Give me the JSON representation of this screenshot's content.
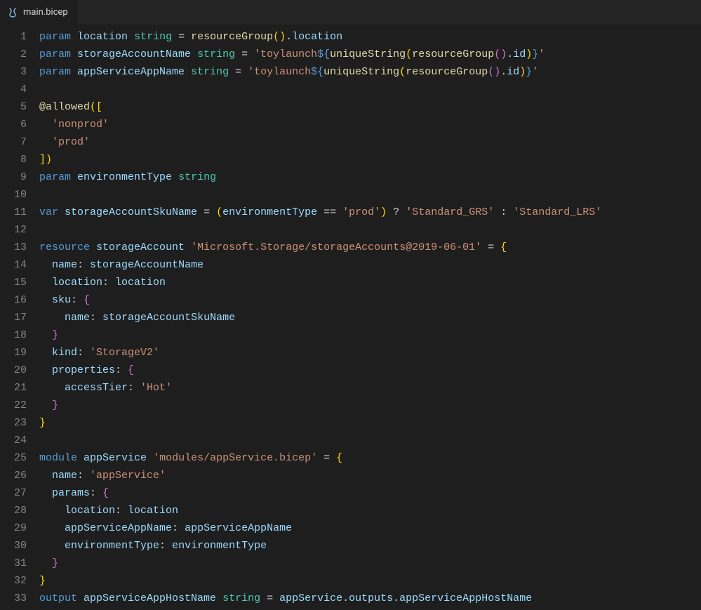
{
  "tab": {
    "filename": "main.bicep"
  },
  "colors": {
    "keyword": "#569cd6",
    "identifier": "#9cdcfe",
    "type": "#4ec9b0",
    "string": "#ce9178",
    "brace1": "#ffd602",
    "brace2": "#d36fd0",
    "function": "#dcdcaa",
    "default": "#d4d4d4",
    "gutter": "#858585",
    "bg": "#1e1e1e"
  },
  "code": [
    [
      {
        "c": "kw",
        "t": "param"
      },
      {
        "c": "op",
        "t": " "
      },
      {
        "c": "ident",
        "t": "location"
      },
      {
        "c": "op",
        "t": " "
      },
      {
        "c": "type",
        "t": "string"
      },
      {
        "c": "op",
        "t": " = "
      },
      {
        "c": "func",
        "t": "resourceGroup"
      },
      {
        "c": "brace",
        "t": "()"
      },
      {
        "c": "op",
        "t": "."
      },
      {
        "c": "ident",
        "t": "location"
      }
    ],
    [
      {
        "c": "kw",
        "t": "param"
      },
      {
        "c": "op",
        "t": " "
      },
      {
        "c": "ident",
        "t": "storageAccountName"
      },
      {
        "c": "op",
        "t": " "
      },
      {
        "c": "type",
        "t": "string"
      },
      {
        "c": "op",
        "t": " = "
      },
      {
        "c": "str",
        "t": "'toylaunch"
      },
      {
        "c": "kw",
        "t": "${"
      },
      {
        "c": "func",
        "t": "uniqueString"
      },
      {
        "c": "gold",
        "t": "("
      },
      {
        "c": "func",
        "t": "resourceGroup"
      },
      {
        "c": "brace2",
        "t": "()"
      },
      {
        "c": "op",
        "t": "."
      },
      {
        "c": "ident",
        "t": "id"
      },
      {
        "c": "gold",
        "t": ")"
      },
      {
        "c": "kw",
        "t": "}"
      },
      {
        "c": "str",
        "t": "'"
      }
    ],
    [
      {
        "c": "kw",
        "t": "param"
      },
      {
        "c": "op",
        "t": " "
      },
      {
        "c": "ident",
        "t": "appServiceAppName"
      },
      {
        "c": "op",
        "t": " "
      },
      {
        "c": "type",
        "t": "string"
      },
      {
        "c": "op",
        "t": " = "
      },
      {
        "c": "str",
        "t": "'toylaunch"
      },
      {
        "c": "kw",
        "t": "${"
      },
      {
        "c": "func",
        "t": "uniqueString"
      },
      {
        "c": "gold",
        "t": "("
      },
      {
        "c": "func",
        "t": "resourceGroup"
      },
      {
        "c": "brace2",
        "t": "()"
      },
      {
        "c": "op",
        "t": "."
      },
      {
        "c": "ident",
        "t": "id"
      },
      {
        "c": "gold",
        "t": ")"
      },
      {
        "c": "kw",
        "t": "}"
      },
      {
        "c": "str",
        "t": "'"
      }
    ],
    [],
    [
      {
        "c": "at",
        "t": "@allowed"
      },
      {
        "c": "brace",
        "t": "(["
      }
    ],
    [
      {
        "c": "op",
        "t": "  "
      },
      {
        "c": "str",
        "t": "'nonprod'"
      }
    ],
    [
      {
        "c": "op",
        "t": "  "
      },
      {
        "c": "str",
        "t": "'prod'"
      }
    ],
    [
      {
        "c": "brace",
        "t": "])"
      }
    ],
    [
      {
        "c": "kw",
        "t": "param"
      },
      {
        "c": "op",
        "t": " "
      },
      {
        "c": "ident",
        "t": "environmentType"
      },
      {
        "c": "op",
        "t": " "
      },
      {
        "c": "type",
        "t": "string"
      }
    ],
    [],
    [
      {
        "c": "kw",
        "t": "var"
      },
      {
        "c": "op",
        "t": " "
      },
      {
        "c": "ident",
        "t": "storageAccountSkuName"
      },
      {
        "c": "op",
        "t": " = "
      },
      {
        "c": "brace",
        "t": "("
      },
      {
        "c": "ident",
        "t": "environmentType"
      },
      {
        "c": "op",
        "t": " == "
      },
      {
        "c": "str",
        "t": "'prod'"
      },
      {
        "c": "brace",
        "t": ")"
      },
      {
        "c": "op",
        "t": " ? "
      },
      {
        "c": "str",
        "t": "'Standard_GRS'"
      },
      {
        "c": "op",
        "t": " : "
      },
      {
        "c": "str",
        "t": "'Standard_LRS'"
      }
    ],
    [],
    [
      {
        "c": "kw",
        "t": "resource"
      },
      {
        "c": "op",
        "t": " "
      },
      {
        "c": "ident",
        "t": "storageAccount"
      },
      {
        "c": "op",
        "t": " "
      },
      {
        "c": "str",
        "t": "'Microsoft.Storage/storageAccounts@2019-06-01'"
      },
      {
        "c": "op",
        "t": " = "
      },
      {
        "c": "brace",
        "t": "{"
      }
    ],
    [
      {
        "c": "op",
        "t": "  "
      },
      {
        "c": "ident",
        "t": "name"
      },
      {
        "c": "op",
        "t": ": "
      },
      {
        "c": "ident",
        "t": "storageAccountName"
      }
    ],
    [
      {
        "c": "op",
        "t": "  "
      },
      {
        "c": "ident",
        "t": "location"
      },
      {
        "c": "op",
        "t": ": "
      },
      {
        "c": "ident",
        "t": "location"
      }
    ],
    [
      {
        "c": "op",
        "t": "  "
      },
      {
        "c": "ident",
        "t": "sku"
      },
      {
        "c": "op",
        "t": ": "
      },
      {
        "c": "brace2",
        "t": "{"
      }
    ],
    [
      {
        "c": "op",
        "t": "    "
      },
      {
        "c": "ident",
        "t": "name"
      },
      {
        "c": "op",
        "t": ": "
      },
      {
        "c": "ident",
        "t": "storageAccountSkuName"
      }
    ],
    [
      {
        "c": "op",
        "t": "  "
      },
      {
        "c": "brace2",
        "t": "}"
      }
    ],
    [
      {
        "c": "op",
        "t": "  "
      },
      {
        "c": "ident",
        "t": "kind"
      },
      {
        "c": "op",
        "t": ": "
      },
      {
        "c": "str",
        "t": "'StorageV2'"
      }
    ],
    [
      {
        "c": "op",
        "t": "  "
      },
      {
        "c": "ident",
        "t": "properties"
      },
      {
        "c": "op",
        "t": ": "
      },
      {
        "c": "brace2",
        "t": "{"
      }
    ],
    [
      {
        "c": "op",
        "t": "    "
      },
      {
        "c": "ident",
        "t": "accessTier"
      },
      {
        "c": "op",
        "t": ": "
      },
      {
        "c": "str",
        "t": "'Hot'"
      }
    ],
    [
      {
        "c": "op",
        "t": "  "
      },
      {
        "c": "brace2",
        "t": "}"
      }
    ],
    [
      {
        "c": "brace",
        "t": "}"
      }
    ],
    [],
    [
      {
        "c": "kw",
        "t": "module"
      },
      {
        "c": "op",
        "t": " "
      },
      {
        "c": "ident",
        "t": "appService"
      },
      {
        "c": "op",
        "t": " "
      },
      {
        "c": "str",
        "t": "'modules/appService.bicep'"
      },
      {
        "c": "op",
        "t": " = "
      },
      {
        "c": "brace",
        "t": "{"
      }
    ],
    [
      {
        "c": "op",
        "t": "  "
      },
      {
        "c": "ident",
        "t": "name"
      },
      {
        "c": "op",
        "t": ": "
      },
      {
        "c": "str",
        "t": "'appService'"
      }
    ],
    [
      {
        "c": "op",
        "t": "  "
      },
      {
        "c": "ident",
        "t": "params"
      },
      {
        "c": "op",
        "t": ": "
      },
      {
        "c": "brace2",
        "t": "{"
      }
    ],
    [
      {
        "c": "op",
        "t": "    "
      },
      {
        "c": "ident",
        "t": "location"
      },
      {
        "c": "op",
        "t": ": "
      },
      {
        "c": "ident",
        "t": "location"
      }
    ],
    [
      {
        "c": "op",
        "t": "    "
      },
      {
        "c": "ident",
        "t": "appServiceAppName"
      },
      {
        "c": "op",
        "t": ": "
      },
      {
        "c": "ident",
        "t": "appServiceAppName"
      }
    ],
    [
      {
        "c": "op",
        "t": "    "
      },
      {
        "c": "ident",
        "t": "environmentType"
      },
      {
        "c": "op",
        "t": ": "
      },
      {
        "c": "ident",
        "t": "environmentType"
      }
    ],
    [
      {
        "c": "op",
        "t": "  "
      },
      {
        "c": "brace2",
        "t": "}"
      }
    ],
    [
      {
        "c": "brace",
        "t": "}"
      }
    ],
    [
      {
        "c": "kw",
        "t": "output"
      },
      {
        "c": "op",
        "t": " "
      },
      {
        "c": "ident",
        "t": "appServiceAppHostName"
      },
      {
        "c": "op",
        "t": " "
      },
      {
        "c": "type",
        "t": "string"
      },
      {
        "c": "op",
        "t": " = "
      },
      {
        "c": "ident",
        "t": "appService"
      },
      {
        "c": "op",
        "t": "."
      },
      {
        "c": "ident",
        "t": "outputs"
      },
      {
        "c": "op",
        "t": "."
      },
      {
        "c": "ident",
        "t": "appServiceAppHostName"
      }
    ]
  ]
}
